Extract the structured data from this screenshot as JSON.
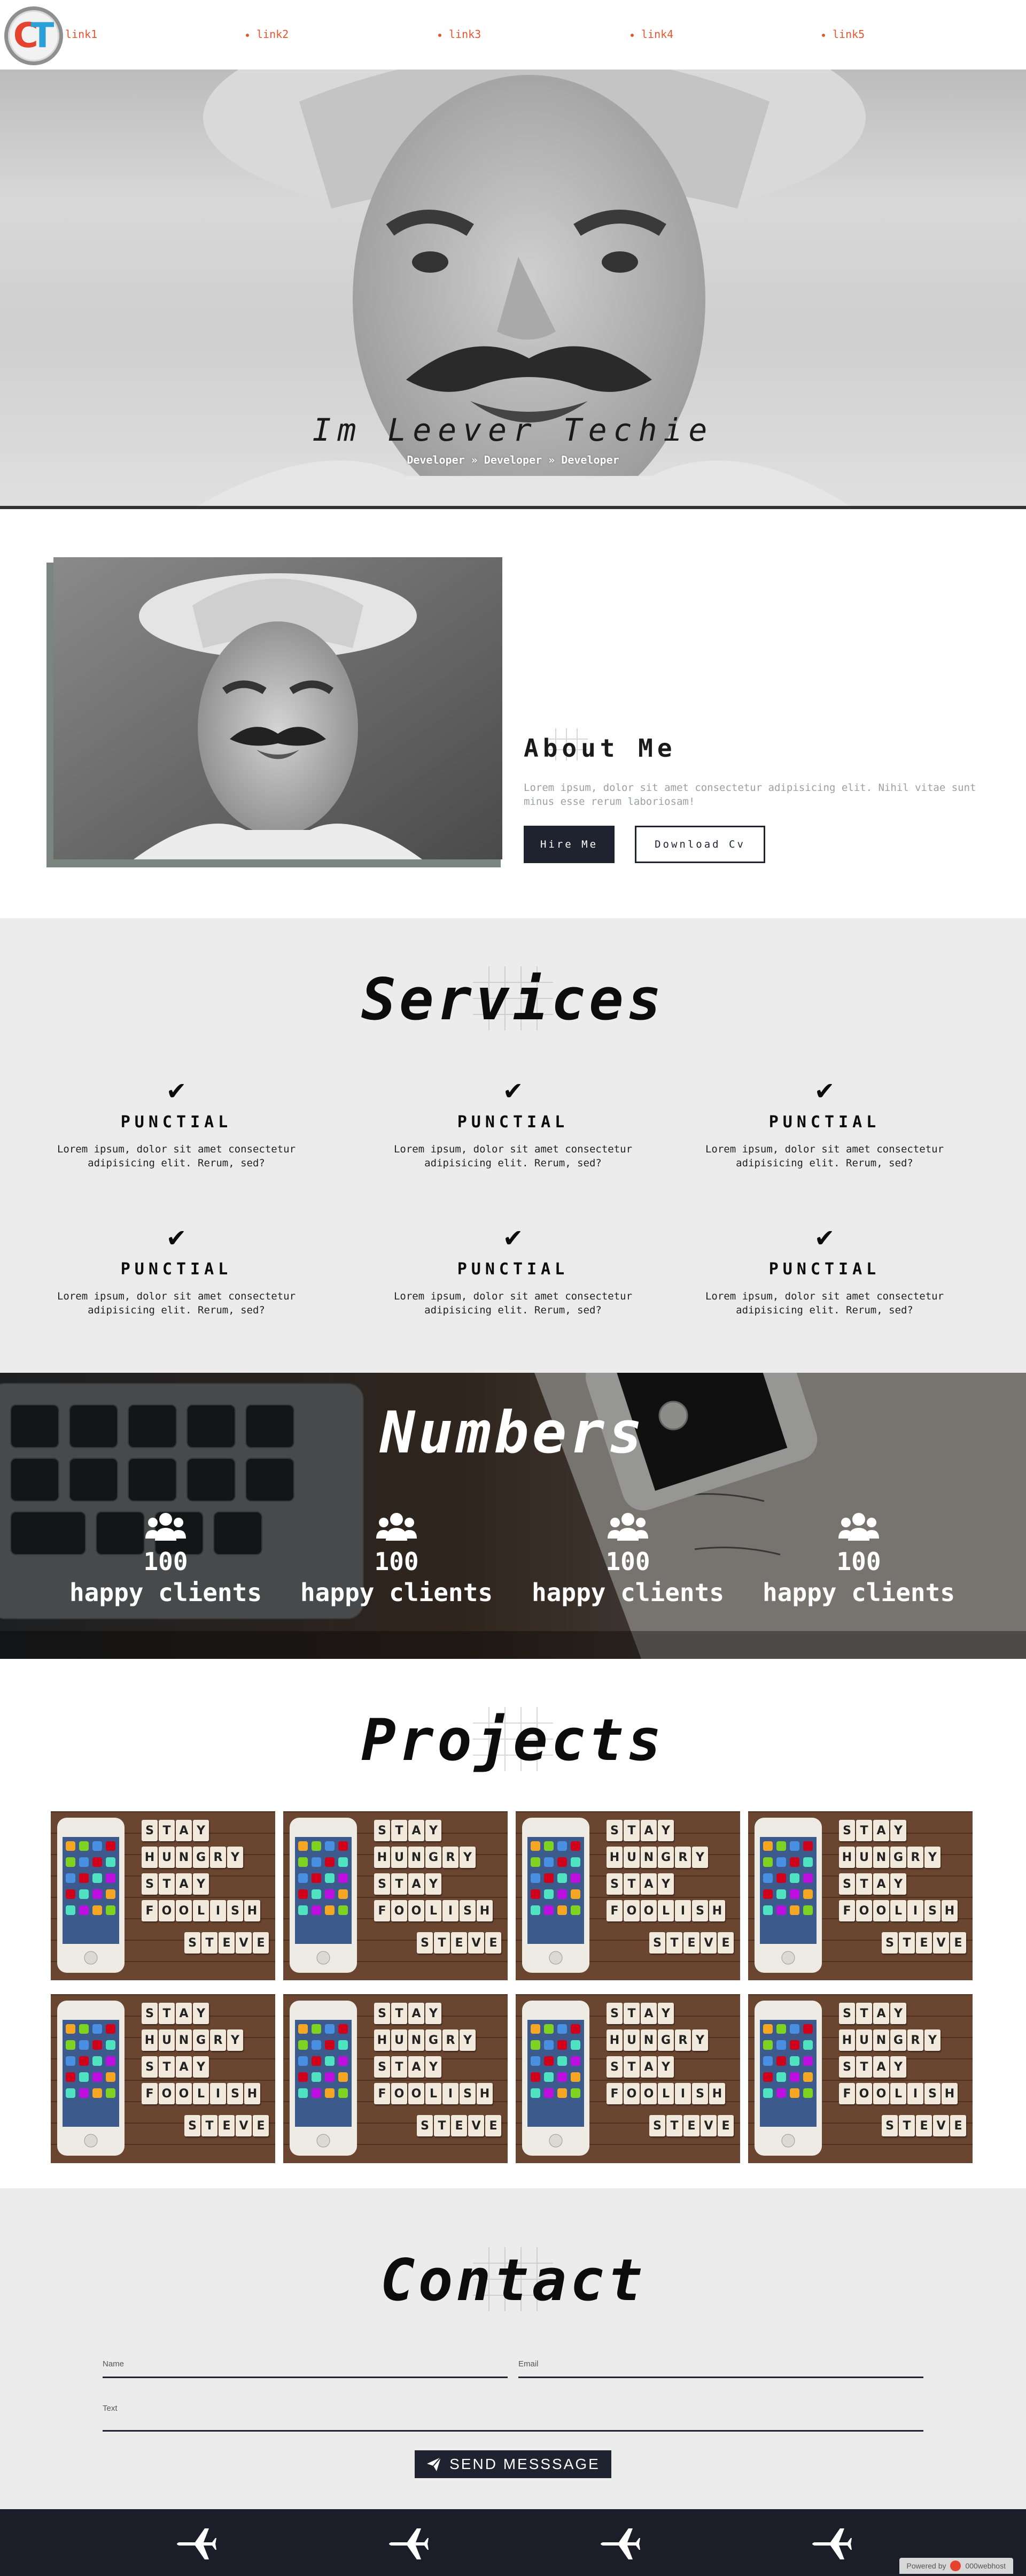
{
  "nav": {
    "logo_letters": [
      "C",
      "T"
    ],
    "links": [
      "link1",
      "link2",
      "link3",
      "link4",
      "link5"
    ]
  },
  "hero": {
    "title": "Im Leever Techie",
    "subtitle": "Developer » Developer » Developer"
  },
  "about": {
    "title": "About Me",
    "text": "Lorem ipsum, dolor sit amet consectetur adipisicing elit. Nihil vitae sunt minus esse rerum laboriosam!",
    "hire_label": "Hire Me",
    "cv_label": "Download Cv"
  },
  "services": {
    "title": "Services",
    "items": [
      {
        "name": "PUNCTIAL",
        "desc": "Lorem ipsum, dolor sit amet consectetur adipisicing elit. Rerum, sed?"
      },
      {
        "name": "PUNCTIAL",
        "desc": "Lorem ipsum, dolor sit amet consectetur adipisicing elit. Rerum, sed?"
      },
      {
        "name": "PUNCTIAL",
        "desc": "Lorem ipsum, dolor sit amet consectetur adipisicing elit. Rerum, sed?"
      },
      {
        "name": "PUNCTIAL",
        "desc": "Lorem ipsum, dolor sit amet consectetur adipisicing elit. Rerum, sed?"
      },
      {
        "name": "PUNCTIAL",
        "desc": "Lorem ipsum, dolor sit amet consectetur adipisicing elit. Rerum, sed?"
      },
      {
        "name": "PUNCTIAL",
        "desc": "Lorem ipsum, dolor sit amet consectetur adipisicing elit. Rerum, sed?"
      }
    ]
  },
  "numbers": {
    "title": "Numbers",
    "stats": [
      {
        "value": "100",
        "label": "happy clients"
      },
      {
        "value": "100",
        "label": "happy clients"
      },
      {
        "value": "100",
        "label": "happy clients"
      },
      {
        "value": "100",
        "label": "happy clients"
      }
    ]
  },
  "projects": {
    "title": "Projects",
    "tiles": [
      "STAY",
      "HUNGRY",
      "STAY",
      "FOOLISH",
      "STEVE"
    ]
  },
  "contact": {
    "title": "Contact",
    "name_label": "Name",
    "email_label": "Email",
    "text_label": "Text",
    "send_label": "SEND MESSSAGE"
  },
  "footer": {
    "powered_label": "Powered by",
    "powered_brand": "000webhost"
  }
}
